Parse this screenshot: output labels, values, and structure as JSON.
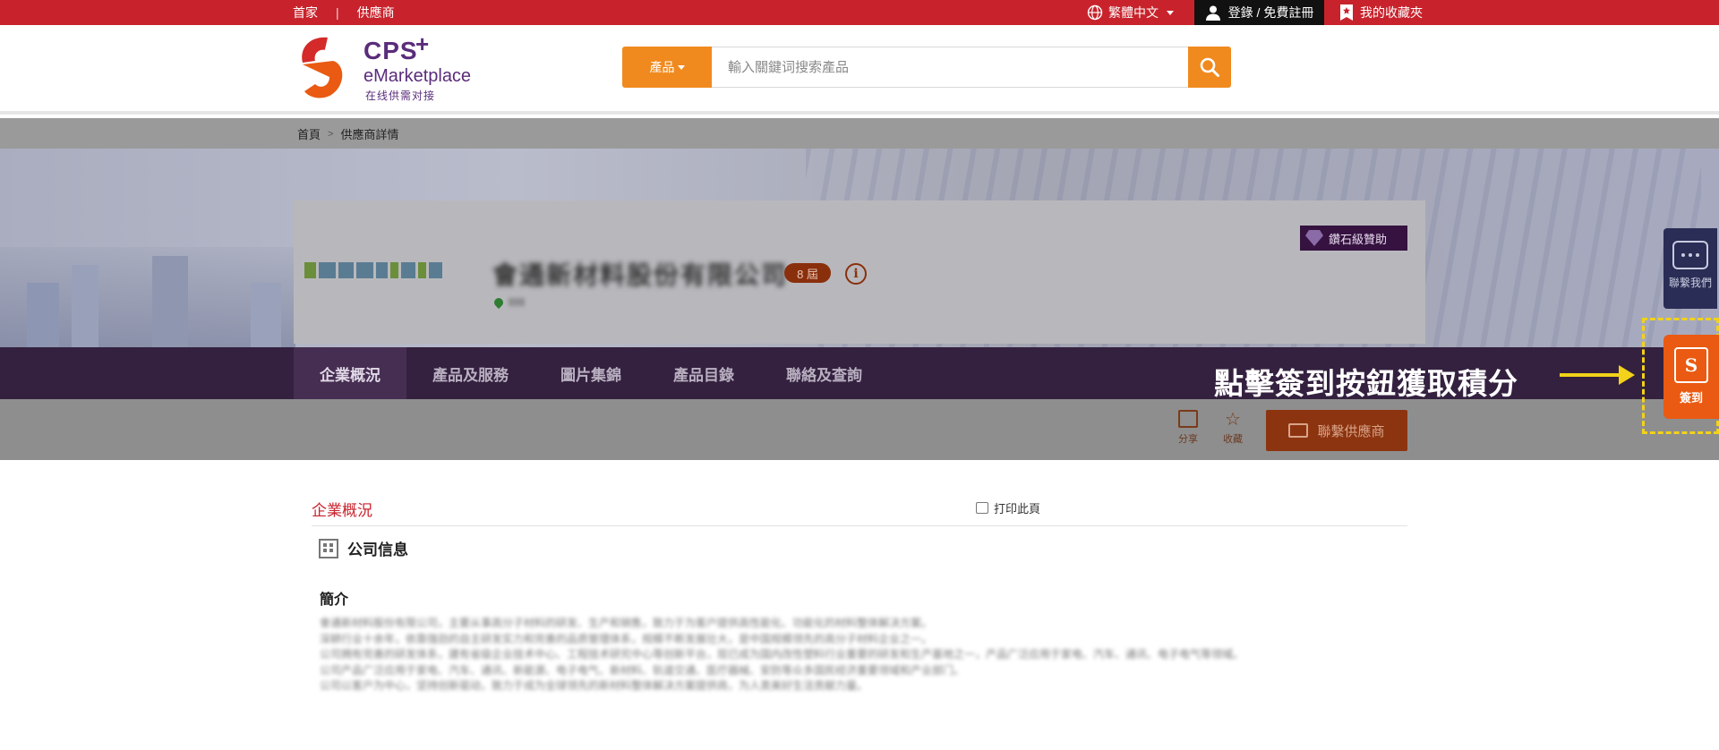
{
  "topbar": {
    "home": "首家",
    "divider": "|",
    "suppliers": "供應商",
    "language": "繁體中文",
    "login": "登錄 / 免費註冊",
    "favorites": "我的收藏夾"
  },
  "header": {
    "logo_cps": "CPS",
    "logo_plus": "+",
    "logo_emarket": "eMarketplace",
    "logo_sub": "在线供需对接",
    "search_category": "產品",
    "search_placeholder": "輸入關鍵词搜索產品"
  },
  "breadcrumb": {
    "home": "首頁",
    "separator": ">",
    "current": "供應商詳情"
  },
  "company": {
    "name": "會通新材料股份有限公司",
    "badge": "8 屆",
    "info_symbol": "i",
    "location": "IIIII",
    "sponsor": "鑽石級贊助"
  },
  "nav": {
    "tabs": [
      "企業概況",
      "產品及服務",
      "圖片集錦",
      "產品目錄",
      "聯絡及查詢"
    ],
    "share": "分享",
    "collect": "收藏",
    "contact_button": "聯繫供應商"
  },
  "annotation": {
    "text": "點擊簽到按鈕獲取積分"
  },
  "floating": {
    "contact_us": "聯繫我們",
    "signin": "簽到"
  },
  "content": {
    "section_title": "企業概況",
    "print": "打印此頁",
    "company_info": "公司信息",
    "intro_heading": "簡介",
    "intro_lines": [
      "會通新材料股份有限公司，主要从事高分子材料的研发、生产和销售，致力于为客户提供高性能化、功能化的材料整体解决方案。",
      "深耕行业十余年，依靠强劲的自主研发实力和完善的品质管理体系，规模不断发展壮大，是中国规模领先的高分子材料企业之一。",
      "公司拥有完善的研发体系，建有省级企业技术中心、工程技术研究中心等创新平台，现已成为国内改性塑料行业重要的研发和生产基地之一，产品广泛应用于家电、汽车、通讯、电子电气等领域。",
      "公司产品广泛应用于家电、汽车、通讯、新能源、电子电气、新材料、轨道交通、医疗器械、安防等众多国民经济重要领域和产业部门。",
      "公司以客户为中心，坚持创新驱动，致力于成为全球领先的新材料整体解决方案提供商，为人类美好生活贡献力量。"
    ]
  },
  "colors": {
    "brand_red": "#c8232c",
    "accent_orange": "#f08a1e",
    "nav_purple": "#34213f",
    "signin_orange": "#ea5a12",
    "annotation_yellow": "#f2d21a"
  }
}
